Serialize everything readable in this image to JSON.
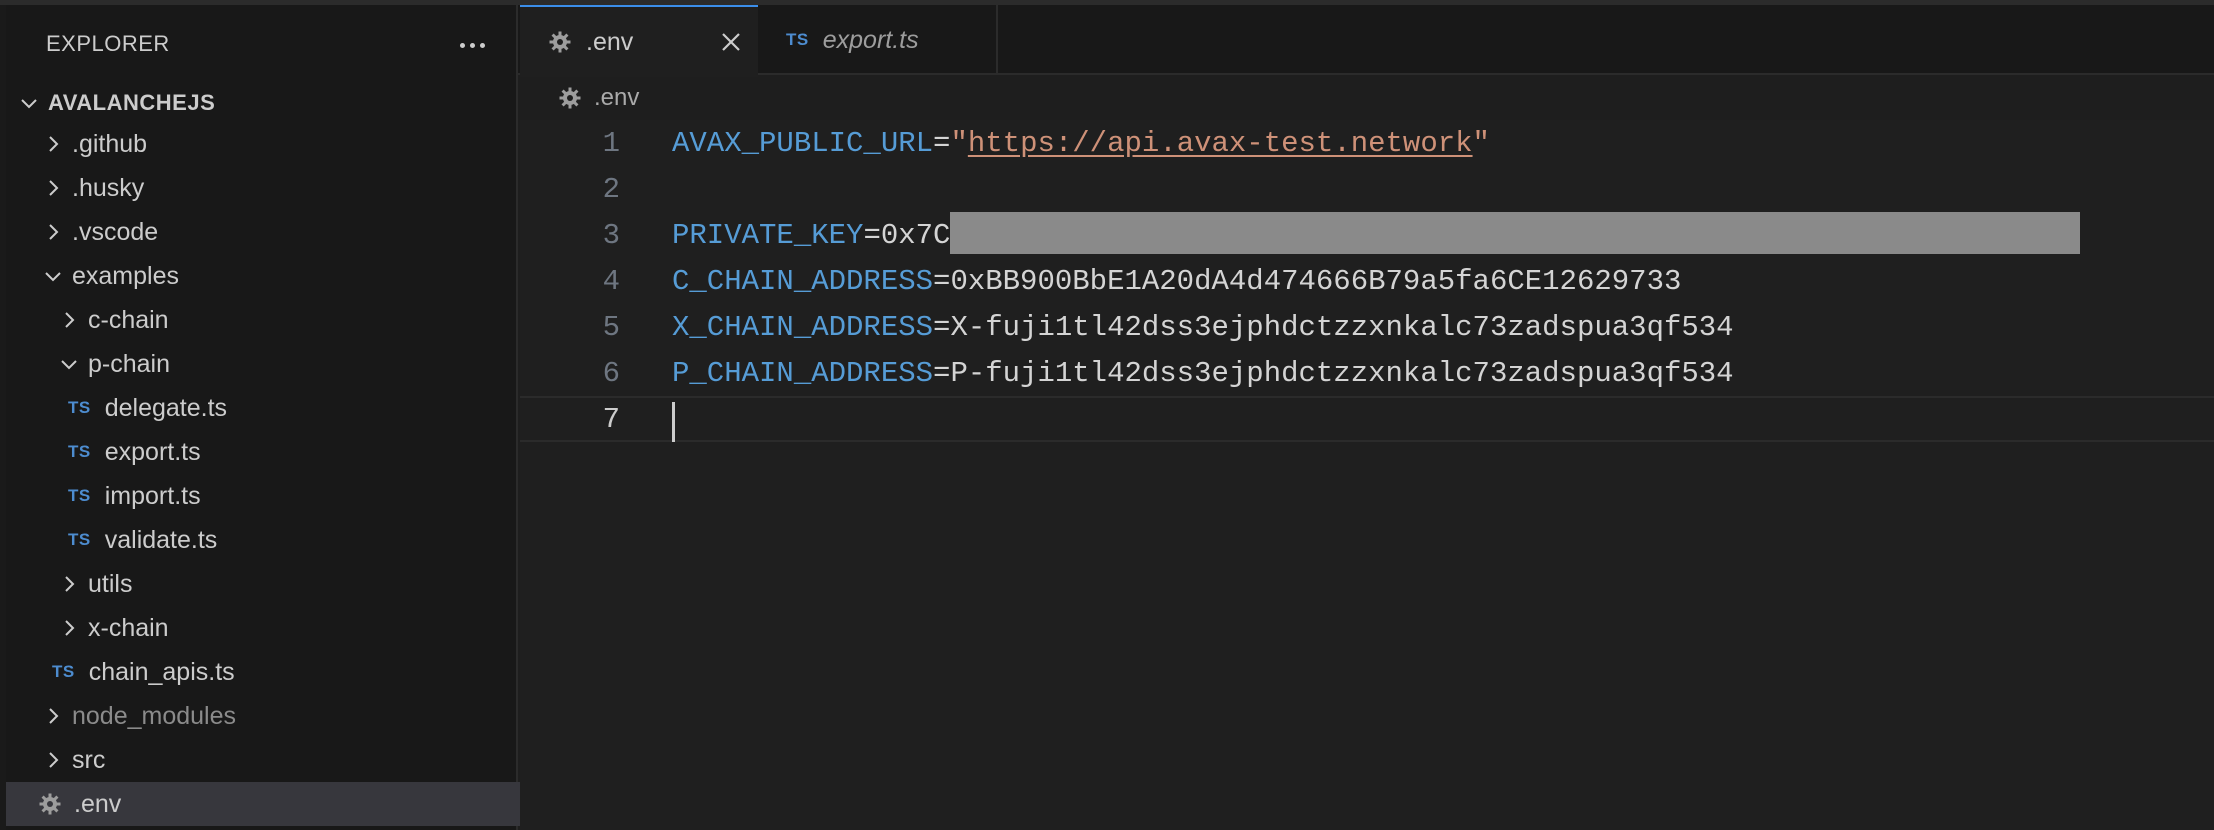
{
  "sidebar": {
    "title": "EXPLORER",
    "root": "AVALANCHEJS",
    "items": [
      {
        "label": ".github"
      },
      {
        "label": ".husky"
      },
      {
        "label": ".vscode"
      },
      {
        "label": "examples"
      },
      {
        "label": "c-chain"
      },
      {
        "label": "p-chain"
      },
      {
        "label": "delegate.ts",
        "badge": "TS"
      },
      {
        "label": "export.ts",
        "badge": "TS"
      },
      {
        "label": "import.ts",
        "badge": "TS"
      },
      {
        "label": "validate.ts",
        "badge": "TS"
      },
      {
        "label": "utils"
      },
      {
        "label": "x-chain"
      },
      {
        "label": "chain_apis.ts",
        "badge": "TS"
      },
      {
        "label": "node_modules"
      },
      {
        "label": "src"
      },
      {
        "label": ".env"
      }
    ]
  },
  "tabs": [
    {
      "label": ".env",
      "active": true
    },
    {
      "label": "export.ts",
      "badge": "TS",
      "active": false
    }
  ],
  "breadcrumb": ".env",
  "editor": {
    "line_numbers": [
      "1",
      "2",
      "3",
      "4",
      "5",
      "6",
      "7"
    ],
    "lines": {
      "l1_key": "AVAX_PUBLIC_URL",
      "l1_eq": "=",
      "l1_quote_open": "\"",
      "l1_url": "https://api.avax-test.network",
      "l1_quote_close": "\"",
      "l3_key": "PRIVATE_KEY",
      "l3_value": "=0x7C",
      "l4_key": "C_CHAIN_ADDRESS",
      "l4_value": "=0xBB900BbE1A20dA4d474666B79a5fa6CE12629733",
      "l5_key": "X_CHAIN_ADDRESS",
      "l5_value": "=X-fuji1tl42dss3ejphdctzzxnkalc73zadspua3qf534",
      "l6_key": "P_CHAIN_ADDRESS",
      "l6_value": "=P-fuji1tl42dss3ejphdctzzxnkalc73zadspua3qf534"
    },
    "current_line": 7
  },
  "colors": {
    "accent": "#3b8eea",
    "key": "#569cd6",
    "string": "#ce9178",
    "ts_badge": "#4d8ccf"
  }
}
